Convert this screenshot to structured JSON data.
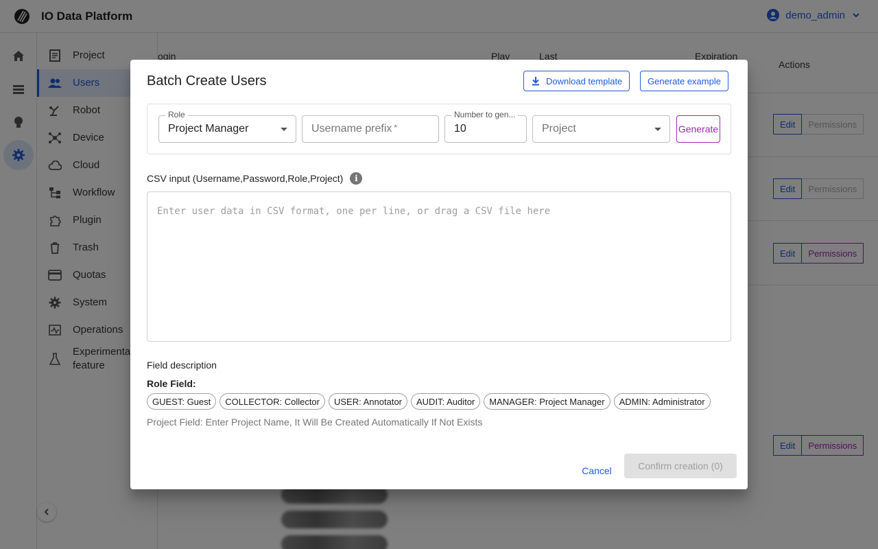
{
  "app": {
    "title": "IO Data Platform",
    "user": "demo_admin"
  },
  "rail": [
    "home-icon",
    "list-icon",
    "bulb-icon",
    "settings-icon"
  ],
  "sidebar": {
    "items": [
      {
        "label": "Project",
        "icon": "document-icon"
      },
      {
        "label": "Users",
        "icon": "users-icon"
      },
      {
        "label": "Robot",
        "icon": "robot-icon"
      },
      {
        "label": "Device",
        "icon": "device-icon"
      },
      {
        "label": "Cloud",
        "icon": "cloud-icon"
      },
      {
        "label": "Workflow",
        "icon": "workflow-icon"
      },
      {
        "label": "Plugin",
        "icon": "plugin-icon"
      },
      {
        "label": "Trash",
        "icon": "trash-icon"
      },
      {
        "label": "Quotas",
        "icon": "card-icon"
      },
      {
        "label": "System",
        "icon": "gear-icon"
      },
      {
        "label": "Operations",
        "icon": "operations-icon"
      },
      {
        "label": "Experimental feature",
        "icon": "flask-icon"
      }
    ]
  },
  "background_table": {
    "headers": {
      "login": "ogin",
      "play": "Play",
      "last": "Last",
      "expiration": "Expiration",
      "actions": "Actions"
    },
    "edit_label": "Edit",
    "permissions_label": "Permissions"
  },
  "dialog": {
    "title": "Batch Create Users",
    "download_template": "Download template",
    "generate_example": "Generate example",
    "role": {
      "label": "Role",
      "value": "Project Manager"
    },
    "username_prefix": {
      "placeholder": "Username prefix",
      "required_mark": "*"
    },
    "number": {
      "label": "Number to gen...",
      "value": "10"
    },
    "project": {
      "placeholder": "Project"
    },
    "generate_button": "Generate",
    "csv_label": "CSV input (Username,Password,Role,Project)",
    "csv_placeholder": "Enter user data in CSV format, one per line, or drag a CSV file here",
    "field_description": "Field description",
    "role_field_title": "Role Field:",
    "roles": [
      "GUEST: Guest",
      "COLLECTOR: Collector",
      "USER: Annotator",
      "AUDIT: Auditor",
      "MANAGER: Project Manager",
      "ADMIN: Administrator"
    ],
    "project_field_desc": "Project Field: Enter Project Name, It Will Be Created Automatically If Not Exists",
    "cancel": "Cancel",
    "confirm": "Confirm creation (0)"
  },
  "colors": {
    "primary": "#1e5bd8",
    "secondary": "#9c27b0",
    "disabled_bg": "#e0e0e0"
  }
}
